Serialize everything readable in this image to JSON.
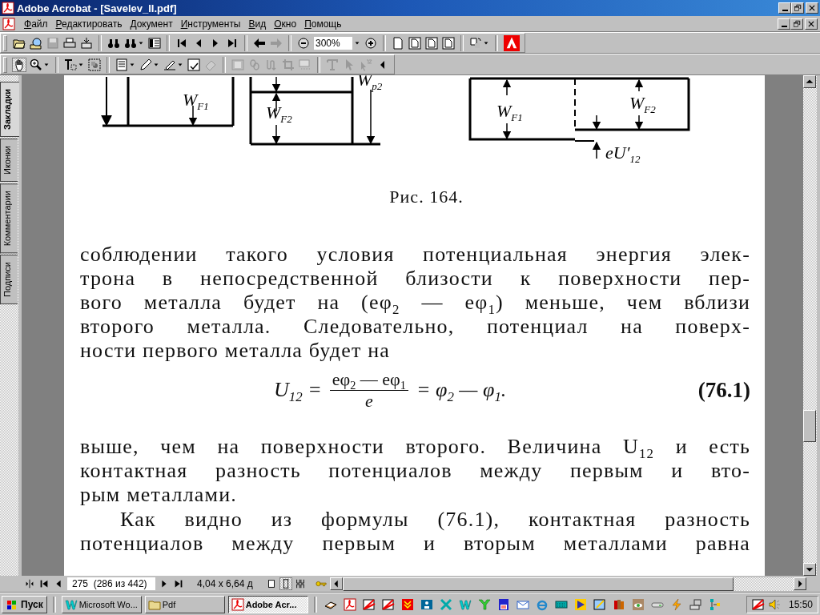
{
  "window": {
    "title": "Adobe Acrobat - [Savelev_II.pdf]"
  },
  "menu": [
    "Файл",
    "Редактировать",
    "Документ",
    "Инструменты",
    "Вид",
    "Окно",
    "Помощь"
  ],
  "toolbar": {
    "zoom": "300%"
  },
  "side_tabs": [
    {
      "label": "Закладки",
      "selected": true
    },
    {
      "label": "Иконки",
      "selected": false
    },
    {
      "label": "Комментарии",
      "selected": false
    },
    {
      "label": "Подписи",
      "selected": false
    }
  ],
  "page": {
    "figure_labels": [
      {
        "main": "W",
        "sub": "F1"
      },
      {
        "main": "W",
        "sub": "F2"
      },
      {
        "main": "W",
        "sub": "p2"
      },
      {
        "main": "W",
        "sub": "F1"
      },
      {
        "main": "W",
        "sub": "F2"
      },
      {
        "main": "eU′",
        "sub": "12"
      }
    ],
    "caption": "Рис. 164.",
    "paragraph_1": [
      "соблюдении такого условия потенциальная энергия элек-",
      "трона в непосредственной близости к поверхности пер-",
      "вого металла будет на (eφ$_{2}$ — eφ$_{1}$) меньше, чем вблизи",
      "второго металла. Следовательно, потенциал на поверх-",
      "ности первого металла будет на"
    ],
    "formula": {
      "lhs": "U$_{12}$ =",
      "numerator": "eφ$_{2}$ — eφ$_{1}$",
      "denominator": "e",
      "rhs": "= φ$_{2}$ — φ$_{1}$.",
      "number": "(76.1)"
    },
    "paragraph_2": [
      "выше, чем на поверхности второго. Величина U$_{12}$ и есть",
      "контактная разность потенциалов между первым и вто-",
      "рым металлами."
    ],
    "paragraph_3": [
      "Как видно из формулы (76.1), контактная разность",
      "потенциалов между первым и вторым металлами равна"
    ]
  },
  "status_bar": {
    "page": "275  (286 из 442)",
    "size": "4,04 x 6,64 д"
  },
  "taskbar": {
    "start": "Пуск",
    "tasks": [
      {
        "label": "Microsoft Wo...",
        "selected": false
      },
      {
        "label": "Pdf",
        "selected": false
      },
      {
        "label": "Adobe Acr...",
        "selected": true
      }
    ],
    "clock": "15:50"
  }
}
